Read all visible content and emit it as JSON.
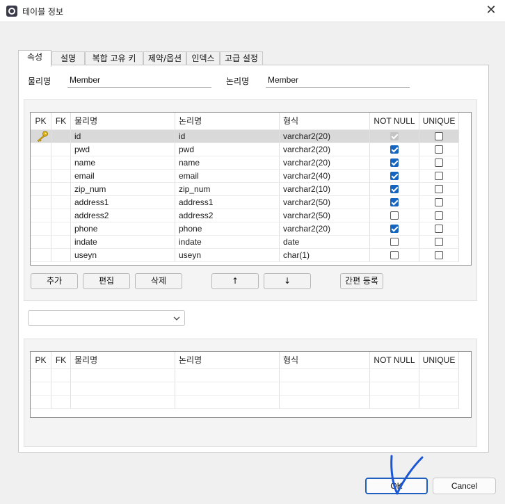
{
  "window": {
    "title": "테이블 정보",
    "close_glyph": "✕"
  },
  "tabs": [
    {
      "label": "속성",
      "active": true
    },
    {
      "label": "설명"
    },
    {
      "label": "복합 고유 키"
    },
    {
      "label": "제약/옵션"
    },
    {
      "label": "인덱스"
    },
    {
      "label": "고급 설정"
    }
  ],
  "form": {
    "physical_label": "물리명",
    "physical_value": "Member",
    "logical_label": "논리명",
    "logical_value": "Member"
  },
  "columns_grid": {
    "headers": [
      "PK",
      "FK",
      "물리명",
      "논리명",
      "형식",
      "NOT NULL",
      "UNIQUE"
    ],
    "rows": [
      {
        "pk": true,
        "physical": "id",
        "logical": "id",
        "type": "varchar2(20)",
        "not_null": true,
        "unique": false,
        "selected": true
      },
      {
        "pk": false,
        "physical": "pwd",
        "logical": "pwd",
        "type": "varchar2(20)",
        "not_null": true,
        "unique": false
      },
      {
        "pk": false,
        "physical": "name",
        "logical": "name",
        "type": "varchar2(20)",
        "not_null": true,
        "unique": false
      },
      {
        "pk": false,
        "physical": "email",
        "logical": "email",
        "type": "varchar2(40)",
        "not_null": true,
        "unique": false
      },
      {
        "pk": false,
        "physical": "zip_num",
        "logical": "zip_num",
        "type": "varchar2(10)",
        "not_null": true,
        "unique": false
      },
      {
        "pk": false,
        "physical": "address1",
        "logical": "address1",
        "type": "varchar2(50)",
        "not_null": true,
        "unique": false
      },
      {
        "pk": false,
        "physical": "address2",
        "logical": "address2",
        "type": "varchar2(50)",
        "not_null": false,
        "unique": false
      },
      {
        "pk": false,
        "physical": "phone",
        "logical": "phone",
        "type": "varchar2(20)",
        "not_null": true,
        "unique": false
      },
      {
        "pk": false,
        "physical": "indate",
        "logical": "indate",
        "type": "date",
        "not_null": false,
        "unique": false
      },
      {
        "pk": false,
        "physical": "useyn",
        "logical": "useyn",
        "type": "char(1)",
        "not_null": false,
        "unique": false
      }
    ]
  },
  "buttons": {
    "add": "추가",
    "edit": "편집",
    "delete": "삭제",
    "move_up": "↑",
    "move_down": "↓",
    "simple_register": "간편 등록"
  },
  "combo": {
    "value": ""
  },
  "index_grid": {
    "headers": [
      "PK",
      "FK",
      "물리명",
      "논리명",
      "형식",
      "NOT NULL",
      "UNIQUE"
    ]
  },
  "dialog": {
    "ok": "OK",
    "cancel": "Cancel"
  },
  "colors": {
    "checkbox_checked": "#1565c0",
    "default_button_border": "#1f5fbf",
    "pen_mark": "#1a56d6"
  },
  "icons": [
    "app-icon",
    "close-icon",
    "key-icon",
    "chevron-down-icon"
  ]
}
